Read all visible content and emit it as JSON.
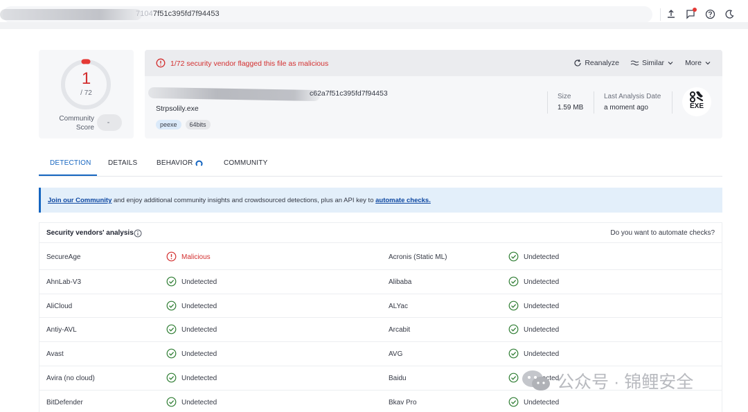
{
  "topbar": {
    "search_value_faded": "7104",
    "search_value": "7f51c395fd7f94453",
    "icons": [
      "upload-icon",
      "flag-icon",
      "help-icon",
      "theme-moon-icon"
    ]
  },
  "community": {
    "score": "1",
    "total": "/ 72",
    "label": "Community Score"
  },
  "summary": {
    "alert": "1/72 security vendor flagged this file as malicious",
    "reanalyze": "Reanalyze",
    "similar": "Similar",
    "more": "More",
    "hash_tail": "c62a7f51c395fd7f94453",
    "file_name": "Strpsolily.exe",
    "tags": [
      "peexe",
      "64bits"
    ],
    "size_label": "Size",
    "size_value": "1.59 MB",
    "last_analysis_label": "Last Analysis Date",
    "last_analysis_value": "a moment ago",
    "file_type": "EXE"
  },
  "tabs": [
    "DETECTION",
    "DETAILS",
    "BEHAVIOR",
    "COMMUNITY"
  ],
  "banner": {
    "link1": "Join our Community",
    "middle": " and enjoy additional community insights and crowdsourced detections, plus an API key to ",
    "link2": "automate checks."
  },
  "vendors": {
    "title": "Security vendors' analysis",
    "automate_prompt": "Do you want to automate checks?",
    "rows": [
      {
        "left_name": "SecureAge",
        "left_result": "Malicious",
        "left_status": "malicious",
        "right_name": "Acronis (Static ML)",
        "right_result": "Undetected"
      },
      {
        "left_name": "AhnLab-V3",
        "left_result": "Undetected",
        "left_status": "undetected",
        "right_name": "Alibaba",
        "right_result": "Undetected"
      },
      {
        "left_name": "AliCloud",
        "left_result": "Undetected",
        "left_status": "undetected",
        "right_name": "ALYac",
        "right_result": "Undetected"
      },
      {
        "left_name": "Antiy-AVL",
        "left_result": "Undetected",
        "left_status": "undetected",
        "right_name": "Arcabit",
        "right_result": "Undetected"
      },
      {
        "left_name": "Avast",
        "left_result": "Undetected",
        "left_status": "undetected",
        "right_name": "AVG",
        "right_result": "Undetected"
      },
      {
        "left_name": "Avira (no cloud)",
        "left_result": "Undetected",
        "left_status": "undetected",
        "right_name": "Baidu",
        "right_result": "Undetected"
      },
      {
        "left_name": "BitDefender",
        "left_result": "Undetected",
        "left_status": "undetected",
        "right_name": "Bkav Pro",
        "right_result": "Undetected"
      }
    ]
  },
  "watermark": {
    "text": "公众号 · 锦鲤安全"
  },
  "colors": {
    "malicious": "#d32f2f",
    "accent": "#1565c0",
    "undetected": "#2e7d32"
  }
}
